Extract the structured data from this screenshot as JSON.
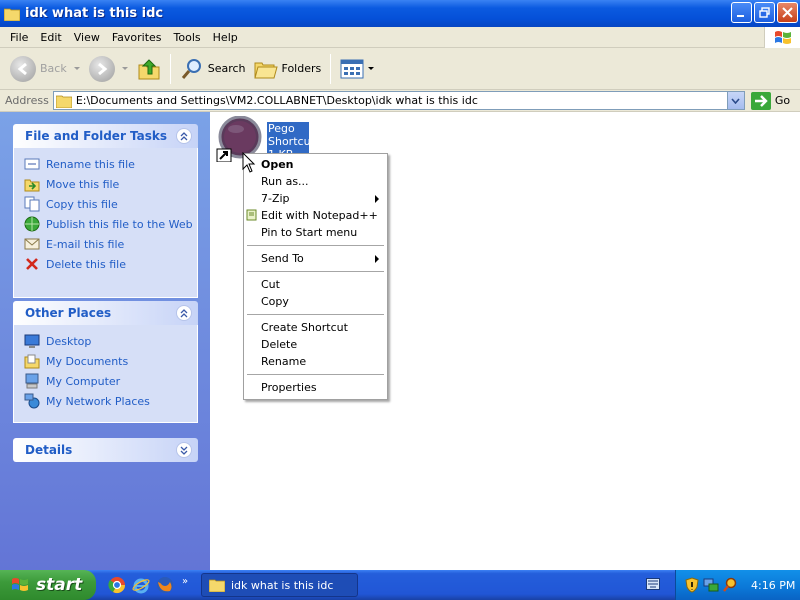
{
  "window": {
    "title": "idk what is this idc"
  },
  "menu": [
    "File",
    "Edit",
    "View",
    "Favorites",
    "Tools",
    "Help"
  ],
  "toolbar": {
    "back": "Back",
    "search": "Search",
    "folders": "Folders"
  },
  "address": {
    "label": "Address",
    "path": "E:\\Documents and Settings\\VM2.COLLABNET\\Desktop\\idk what is this idc",
    "go": "Go"
  },
  "tasks": {
    "title": "File and Folder Tasks",
    "items": [
      "Rename this file",
      "Move this file",
      "Copy this file",
      "Publish this file to the Web",
      "E-mail this file",
      "Delete this file"
    ]
  },
  "places": {
    "title": "Other Places",
    "items": [
      "Desktop",
      "My Documents",
      "My Computer",
      "My Network Places"
    ]
  },
  "details": {
    "title": "Details"
  },
  "file": {
    "label_line1": "Pego",
    "label_line2": "Shortcut",
    "label_line3": "1 KB"
  },
  "context_menu": {
    "open": "Open",
    "run_as": "Run as...",
    "zip": "7-Zip",
    "notepad": "Edit with Notepad++",
    "pin": "Pin to Start menu",
    "send_to": "Send To",
    "cut": "Cut",
    "copy": "Copy",
    "create_shortcut": "Create Shortcut",
    "delete": "Delete",
    "rename": "Rename",
    "properties": "Properties"
  },
  "taskbar": {
    "start": "start",
    "window_button": "idk what is this idc",
    "clock": "4:16 PM"
  },
  "colors": {
    "title_blue": "#0550d8",
    "panel_link": "#215dc6",
    "selection": "#316ac5",
    "start_green": "#3c9a3a"
  }
}
